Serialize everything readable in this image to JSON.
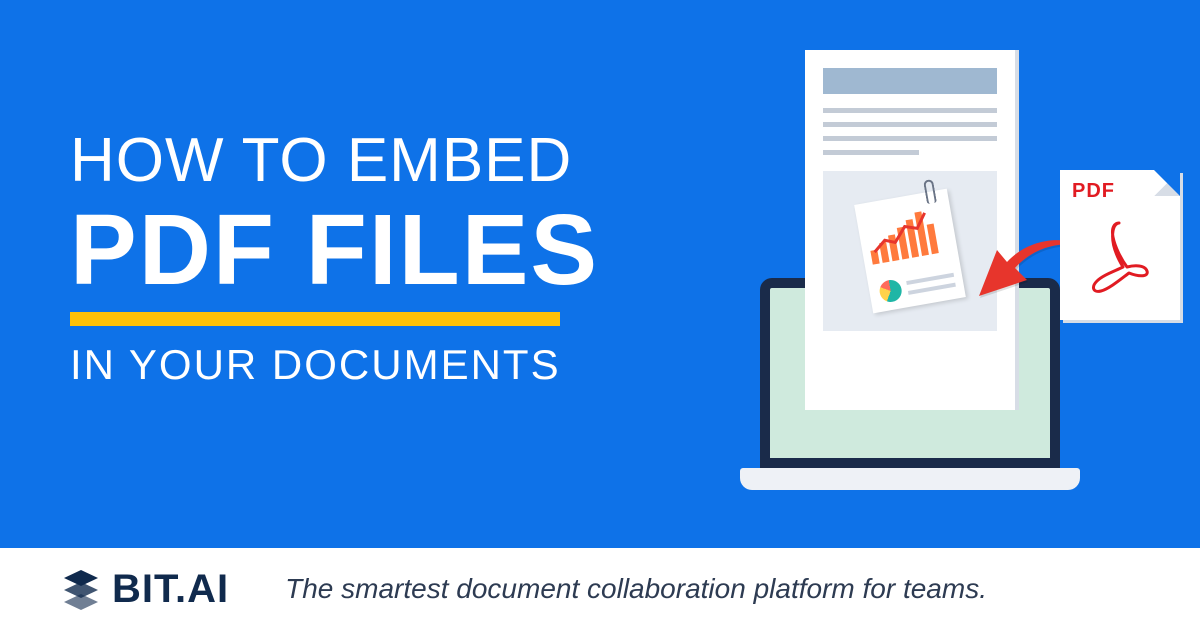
{
  "headline": {
    "line1": "How to Embed",
    "line2": "PDF Files",
    "line3": "In Your Documents"
  },
  "pdf_icon": {
    "label": "PDF"
  },
  "footer": {
    "brand": "BIT.AI",
    "tagline": "The smartest document collaboration platform for teams."
  },
  "colors": {
    "bg": "#0e72e8",
    "accent": "#ffc107",
    "arrow": "#e7352c",
    "pdf_red": "#e11b22"
  }
}
